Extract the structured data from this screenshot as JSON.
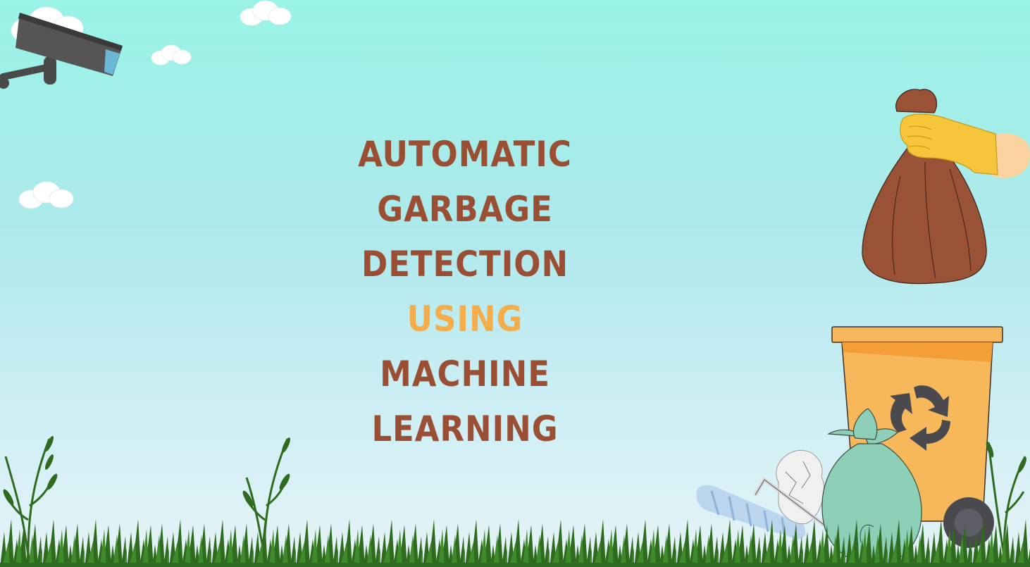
{
  "title": {
    "line1": "Automatic",
    "line2": "Garbage Detection",
    "line3": "Using",
    "line4": "Machine Learning"
  },
  "colors": {
    "title_brown": "#9a4f35",
    "title_accent": "#f5ac4b",
    "sky_top": "#99f3e6",
    "sky_bottom": "#e6f3f7",
    "bin_orange": "#f7b85c",
    "grass_green": "#2f6b1e"
  },
  "icons": {
    "camera": "security-camera-icon",
    "recycle": "recycle-icon",
    "bag": "garbage-bag-icon",
    "bin": "trash-bin-icon"
  }
}
